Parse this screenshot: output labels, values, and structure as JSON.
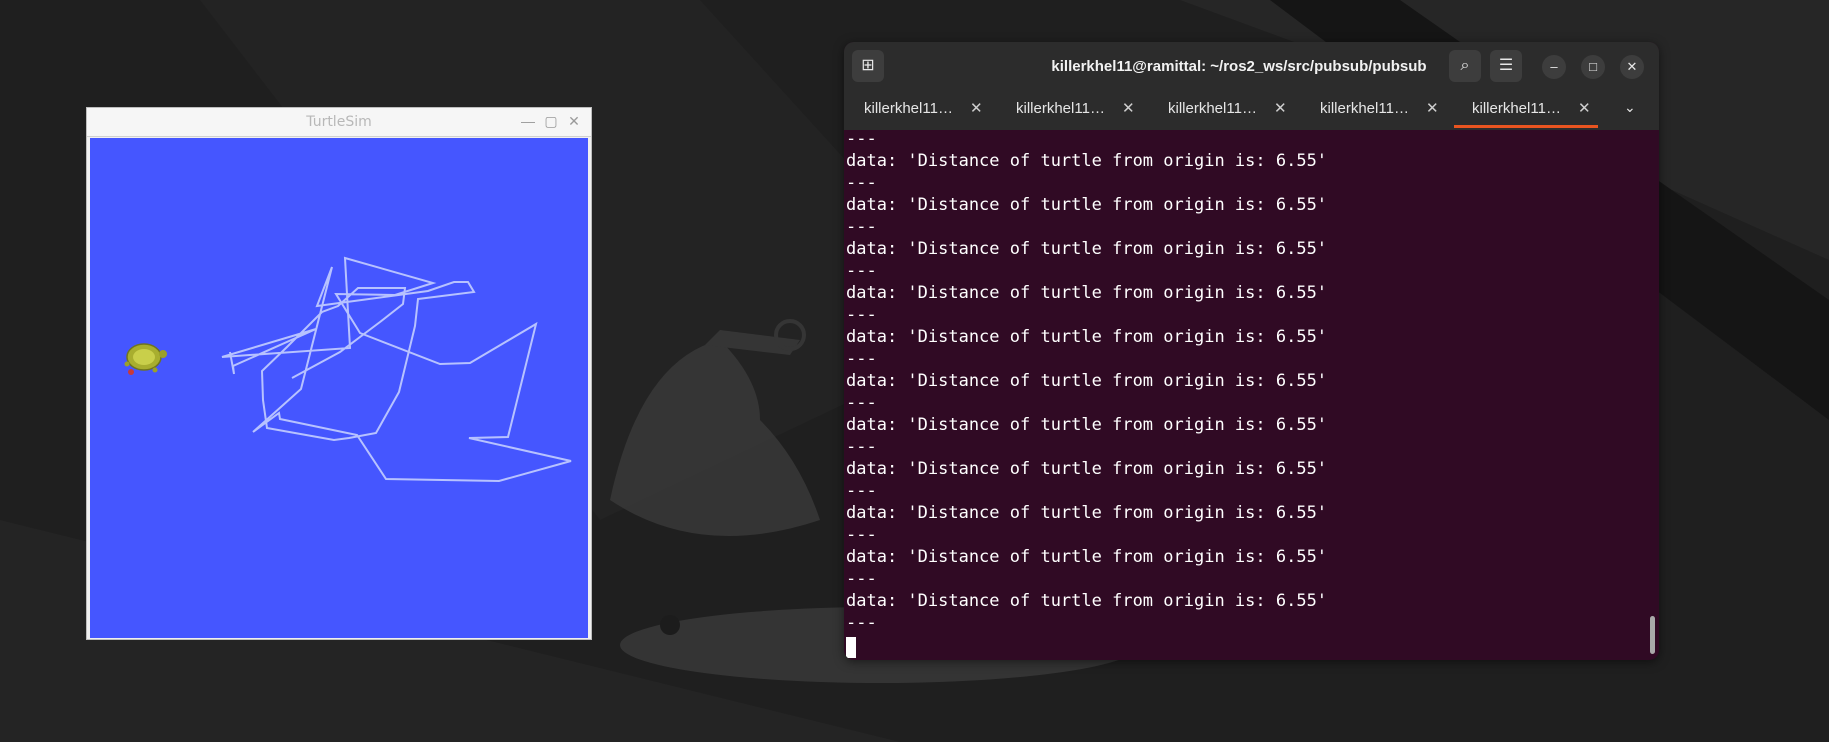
{
  "turtlesim": {
    "title": "TurtleSim",
    "controls": {
      "minimize": "—",
      "maximize": "▢",
      "close": "✕"
    },
    "background_color": "#4556ff",
    "path_color": "#b7c2ff"
  },
  "terminal": {
    "title": "killerkhel11@ramittal: ~/ros2_ws/src/pubsub/pubsub",
    "new_tab_icon": "new-tab-icon",
    "tabs": [
      {
        "label": "killerkhel11@ramittal: ~",
        "active": false
      },
      {
        "label": "killerkhel11@ramittal: ~",
        "active": false
      },
      {
        "label": "killerkhel11@ramittal: ~",
        "active": false
      },
      {
        "label": "killerkhel11@ramittal: ~",
        "active": false
      },
      {
        "label": "killerkhel11@ramittal: ~/ros2_ws/src/pubsub/pubsub",
        "active": true
      }
    ],
    "output": [
      "---",
      "data: 'Distance of turtle from origin is: 6.55'",
      "---",
      "data: 'Distance of turtle from origin is: 6.55'",
      "---",
      "data: 'Distance of turtle from origin is: 6.55'",
      "---",
      "data: 'Distance of turtle from origin is: 6.55'",
      "---",
      "data: 'Distance of turtle from origin is: 6.55'",
      "---",
      "data: 'Distance of turtle from origin is: 6.55'",
      "---",
      "data: 'Distance of turtle from origin is: 6.55'",
      "---",
      "data: 'Distance of turtle from origin is: 6.55'",
      "---",
      "data: 'Distance of turtle from origin is: 6.55'",
      "---",
      "data: 'Distance of turtle from origin is: 6.55'",
      "---",
      "data: 'Distance of turtle from origin is: 6.55'",
      "---"
    ],
    "background_color": "#300a24",
    "accent_color": "#e95420"
  }
}
